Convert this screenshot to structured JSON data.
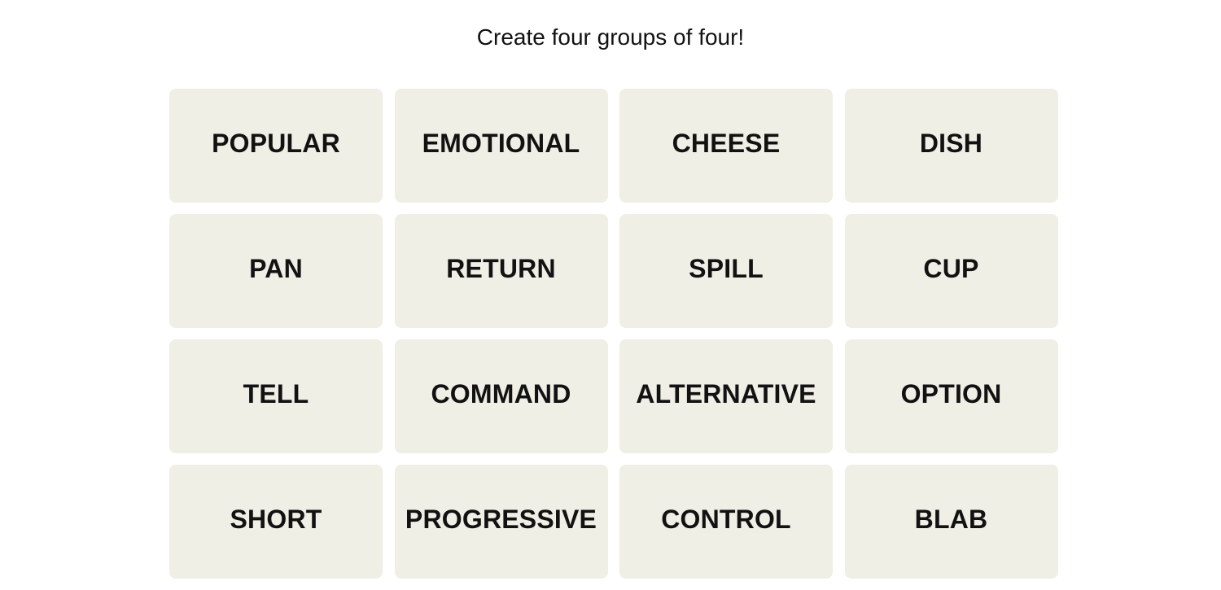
{
  "header": {
    "instructions": "Create four groups of four!"
  },
  "board": {
    "tile_color": "#efefe6",
    "text_color": "#121212",
    "tiles": [
      "POPULAR",
      "EMOTIONAL",
      "CHEESE",
      "DISH",
      "PAN",
      "RETURN",
      "SPILL",
      "CUP",
      "TELL",
      "COMMAND",
      "ALTERNATIVE",
      "OPTION",
      "SHORT",
      "PROGRESSIVE",
      "CONTROL",
      "BLAB"
    ]
  }
}
